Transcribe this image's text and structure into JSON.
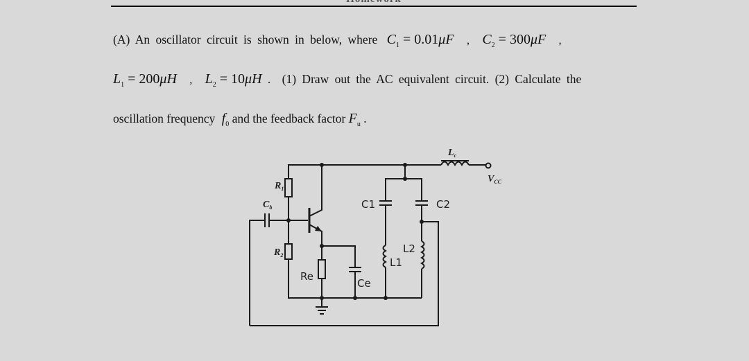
{
  "document": {
    "cropped_heading": "Homework",
    "problem": {
      "label": "(A)",
      "intro": "An oscillator circuit is shown in below, where",
      "given": {
        "C1": {
          "symbol": "C",
          "sub": "1",
          "value": "0.01",
          "unit": "μF"
        },
        "C2": {
          "symbol": "C",
          "sub": "2",
          "value": "300",
          "unit": "μF"
        },
        "L1": {
          "symbol": "L",
          "sub": "1",
          "value": "200",
          "unit": "μH"
        },
        "L2": {
          "symbol": "L",
          "sub": "2",
          "value": "10",
          "unit": "μH"
        }
      },
      "separator": ",",
      "task1": "(1) Draw out the AC equivalent circuit.",
      "task2_part1": "(2) Calculate the",
      "task2_part2": "oscillation frequency",
      "f0": {
        "symbol": "f",
        "sub": "0"
      },
      "task2_part3": "and the feedback factor",
      "Fu": {
        "symbol": "F",
        "sub": "u"
      },
      "end": "."
    }
  },
  "circuit": {
    "labels": {
      "R1": {
        "main": "R",
        "sub": "1"
      },
      "R2": {
        "main": "R",
        "sub": "2"
      },
      "Cb": {
        "main": "C",
        "sub": "b"
      },
      "Lc": {
        "main": "L",
        "sub": "c"
      },
      "Vcc": {
        "main": "V",
        "sub": "CC"
      },
      "C1": "C1",
      "C2": "C2",
      "L1": "L1",
      "L2": "L2",
      "Re": "Re",
      "Ce": "Ce"
    }
  }
}
